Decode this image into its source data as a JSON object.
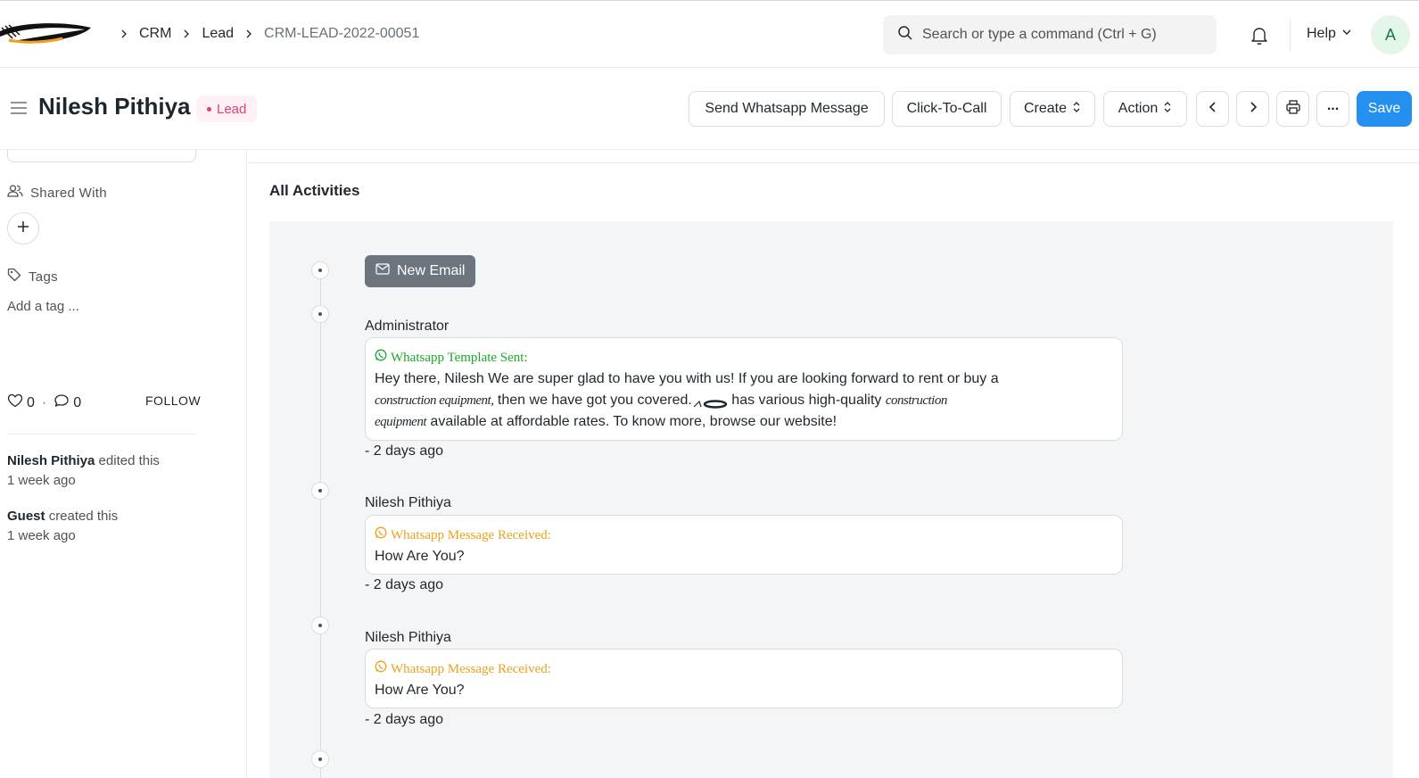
{
  "navbar": {
    "breadcrumbs": [
      "CRM",
      "Lead",
      "CRM-LEAD-2022-00051"
    ],
    "search_placeholder": "Search or type a command (Ctrl + G)",
    "help_label": "Help",
    "avatar_initial": "A"
  },
  "page": {
    "title": "Nilesh Pithiya",
    "status": "Lead",
    "status_color": "#e03e7b",
    "buttons": {
      "whatsapp": "Send Whatsapp Message",
      "call": "Click-To-Call",
      "create": "Create",
      "action": "Action",
      "more": "...",
      "save": "Save"
    }
  },
  "sidebar": {
    "shared_with_label": "Shared With",
    "tags_label": "Tags",
    "add_tag_placeholder": "Add a tag ...",
    "likes_count": "0",
    "comments_count": "0",
    "follow_label": "FOLLOW",
    "activity": [
      {
        "user": "Nilesh Pithiya",
        "action": "edited this",
        "time": "1 week ago"
      },
      {
        "user": "Guest",
        "action": "created this",
        "time": "1 week ago"
      }
    ]
  },
  "main": {
    "heading": "All Activities",
    "new_email_label": "New Email",
    "timeline": [
      {
        "author": "Administrator",
        "header": "Whatsapp Template Sent:",
        "header_color": "#18a82a",
        "body_line1": "Hey there, Nilesh We are super glad to have you with us! If you are looking forward to rent or buy a",
        "body_line2_a": "construction equipment,",
        "body_line2_b": " then we have got you covered.",
        "body_line2_c": " has various high-quality ",
        "body_line2_d": "construction",
        "body_line3_a": "equipment",
        "body_line3_b": " available at affordable rates. To know more, browse our website!",
        "time": "- 2 days ago"
      },
      {
        "author": "Nilesh Pithiya",
        "header": "Whatsapp Message Received:",
        "header_color": "#e8a31b",
        "body": "How Are You?",
        "time": "- 2 days ago"
      },
      {
        "author": "Nilesh Pithiya",
        "header": "Whatsapp Message Received:",
        "header_color": "#e8a31b",
        "body": "How Are You?",
        "time": "- 2 days ago"
      }
    ]
  }
}
